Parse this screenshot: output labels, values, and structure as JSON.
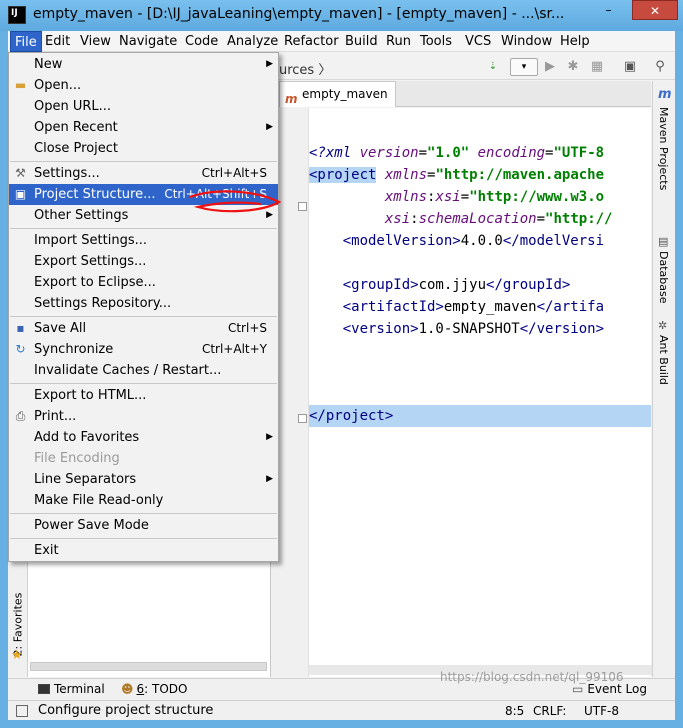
{
  "window": {
    "title": "empty_maven - [D:\\IJ_javaLeaning\\empty_maven] - [empty_maven] - ...\\sr...",
    "minimize": "–",
    "maximize": "□",
    "close": "✕"
  },
  "menubar": [
    {
      "label": "File",
      "active": true
    },
    {
      "label": "Edit"
    },
    {
      "label": "View"
    },
    {
      "label": "Navigate"
    },
    {
      "label": "Code"
    },
    {
      "label": "Analyze"
    },
    {
      "label": "Refactor"
    },
    {
      "label": "Build"
    },
    {
      "label": "Run"
    },
    {
      "label": "Tools"
    },
    {
      "label": "VCS"
    },
    {
      "label": "Window"
    },
    {
      "label": "Help"
    }
  ],
  "toolbar": {
    "breadcrumb": "ources",
    "breadcrumb_arrow": "〉"
  },
  "editor_tab": {
    "label": "empty_maven",
    "icon": "m"
  },
  "file_menu": [
    {
      "label": "New",
      "submenu": true
    },
    {
      "label": "Open...",
      "icon": "folder-icon"
    },
    {
      "label": "Open URL..."
    },
    {
      "label": "Open Recent",
      "submenu": true
    },
    {
      "label": "Close Project"
    },
    {
      "sep": true
    },
    {
      "label": "Settings...",
      "shortcut": "Ctrl+Alt+S",
      "icon": "wrench-icon"
    },
    {
      "label": "Project Structure...",
      "shortcut": "Ctrl+Alt+Shift+S",
      "icon": "project-structure-icon",
      "selected": true
    },
    {
      "label": "Other Settings",
      "submenu": true
    },
    {
      "sep": true
    },
    {
      "label": "Import Settings..."
    },
    {
      "label": "Export Settings..."
    },
    {
      "label": "Export to Eclipse..."
    },
    {
      "label": "Settings Repository..."
    },
    {
      "sep": true
    },
    {
      "label": "Save All",
      "shortcut": "Ctrl+S",
      "icon": "save-icon"
    },
    {
      "label": "Synchronize",
      "shortcut": "Ctrl+Alt+Y",
      "icon": "sync-icon"
    },
    {
      "label": "Invalidate Caches / Restart..."
    },
    {
      "sep": true
    },
    {
      "label": "Export to HTML..."
    },
    {
      "label": "Print...",
      "icon": "print-icon"
    },
    {
      "label": "Add to Favorites",
      "submenu": true
    },
    {
      "label": "File Encoding",
      "disabled": true
    },
    {
      "label": "Line Separators",
      "submenu": true
    },
    {
      "label": "Make File Read-only"
    },
    {
      "sep": true
    },
    {
      "label": "Power Save Mode"
    },
    {
      "sep": true
    },
    {
      "label": "Exit"
    }
  ],
  "code": {
    "line1": {
      "a": "<?xml ",
      "b": "version",
      "c": "=",
      "d": "\"1.0\"",
      "e": " encoding",
      "f": "=",
      "g": "\"UTF-8"
    },
    "line2": {
      "a": "<project",
      "b": " xmlns",
      "c": "=",
      "d": "\"http://maven.apache"
    },
    "line3": {
      "a": "         xmlns",
      "b": ":",
      "c": "xsi",
      "d": "=",
      "e": "\"http://www.w3.o"
    },
    "line4": {
      "a": "         xsi",
      "b": ":",
      "c": "schemaLocation",
      "d": "=",
      "e": "\"http://"
    },
    "line5": {
      "a": "    <modelVersion>",
      "b": "4.0.0",
      "c": "</modelVersi"
    },
    "line6": {
      "a": "    <groupId>",
      "b": "com.jjyu",
      "c": "</groupId>"
    },
    "line7": {
      "a": "    <artifactId>",
      "b": "empty_maven",
      "c": "</artifa"
    },
    "line8": {
      "a": "    <version>",
      "b": "1.0-SNAPSHOT",
      "c": "</version>"
    },
    "line9": {
      "a": "</project>"
    }
  },
  "right_tools": {
    "maven": "Maven Projects",
    "database": "Database",
    "ant": "Ant Build"
  },
  "left_tools": {
    "favorites": "2: Favorites"
  },
  "bottom_tools": {
    "terminal": "Terminal",
    "todo_num": "6",
    "todo": ": TODO",
    "event_log": "Event Log"
  },
  "status": {
    "message": "Configure project structure",
    "position": "8:5",
    "line_sep": "CRLF:",
    "encoding": "UTF-8"
  },
  "watermark": "https://blog.csdn.net/ql_99106"
}
